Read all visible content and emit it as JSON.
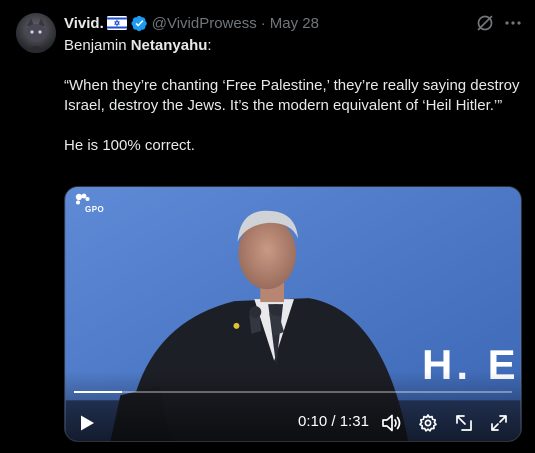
{
  "post": {
    "author": {
      "display_name": "Vivid.",
      "flag_icon": "israel-flag-icon",
      "verified_icon": "verified-badge-icon",
      "handle": "@VividProwess",
      "separator": "·",
      "date": "May 28"
    },
    "header_actions": {
      "grok_icon": "grok-icon",
      "more_icon": "more-icon"
    },
    "text": {
      "line1_prefix": "Benjamin ",
      "line1_bold": "Netanyahu",
      "line1_suffix": ":",
      "quote": "“When they’re chanting ‘Free Palestine,’ they’re really saying destroy Israel, destroy the Jews. It’s the modern equivalent of ‘Heil Hitler.’”",
      "closing": "He is 100% correct."
    },
    "video": {
      "logo_text": "GPO",
      "wall_text": "H. E.",
      "current_time": "0:10",
      "time_separator": " / ",
      "duration": "1:31",
      "progress": 0.11,
      "controls": [
        "play-icon",
        "volume-icon",
        "settings-icon",
        "pip-icon",
        "fullscreen-icon"
      ]
    }
  },
  "colors": {
    "background": "#000000",
    "text_primary": "#e7e9ea",
    "text_secondary": "#71767b",
    "verified_blue": "#1d9bf0",
    "video_wall_blue": "#4a76c4"
  }
}
